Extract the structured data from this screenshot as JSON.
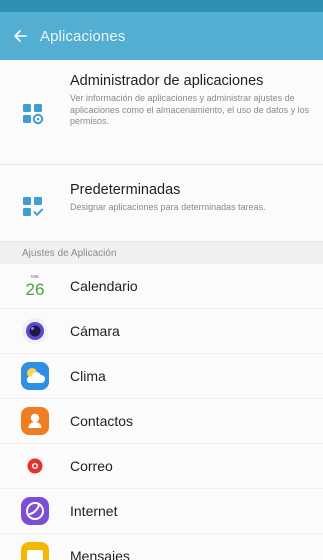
{
  "appbar": {
    "title": "Aplicaciones",
    "back_icon": "arrow-left-icon",
    "color": "#53aed2"
  },
  "settings_items": [
    {
      "title": "Administrador de aplicaciones",
      "description": "Ver información de aplicaciones y administrar ajustes de aplicaciones como el almacenamiento, el uso de datos y los permisos.",
      "icon": "app-manager-icon"
    },
    {
      "title": "Predeterminadas",
      "description": "Designar aplicaciones para determinadas tareas.",
      "icon": "default-apps-icon"
    }
  ],
  "section_header": "Ajustes de Aplicación",
  "apps": [
    {
      "label": "Calendario",
      "icon": "calendar-icon",
      "icon_text": "26",
      "icon_small_text": "MIE"
    },
    {
      "label": "Cámara",
      "icon": "camera-icon"
    },
    {
      "label": "Clima",
      "icon": "weather-icon"
    },
    {
      "label": "Contactos",
      "icon": "contacts-icon"
    },
    {
      "label": "Correo",
      "icon": "email-icon"
    },
    {
      "label": "Internet",
      "icon": "internet-icon"
    },
    {
      "label": "Mensajes",
      "icon": "messages-icon"
    }
  ]
}
